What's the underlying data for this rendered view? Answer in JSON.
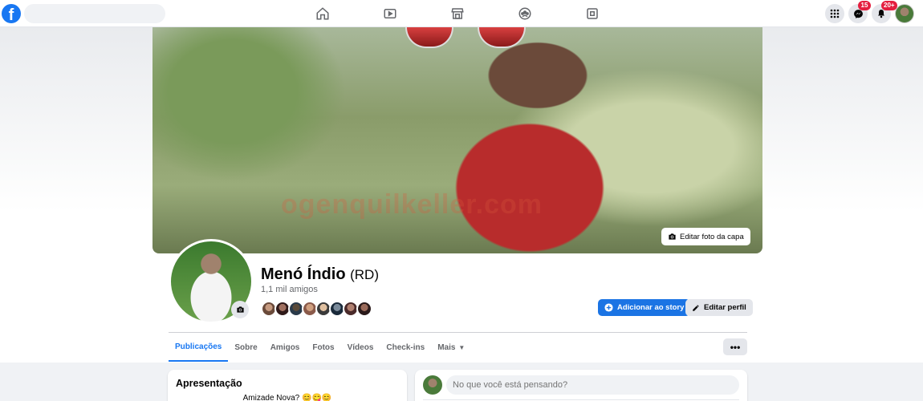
{
  "topbar": {
    "search_placeholder": "",
    "messenger_badge": "15",
    "notifications_badge": "20+"
  },
  "cover": {
    "edit_label": "Editar foto da capa"
  },
  "profile": {
    "name": "Menó Índio",
    "alternate_name": "(RD)",
    "friends_count": "1,1 mil amigos",
    "add_story_label": "Adicionar ao story",
    "edit_profile_label": "Editar perfil"
  },
  "tabs": [
    {
      "label": "Publicações",
      "active": true
    },
    {
      "label": "Sobre"
    },
    {
      "label": "Amigos"
    },
    {
      "label": "Fotos"
    },
    {
      "label": "Vídeos"
    },
    {
      "label": "Check-ins"
    },
    {
      "label": "Mais"
    }
  ],
  "more_label": "•••",
  "intro": {
    "title": "Apresentação",
    "bio": "Amizade Nova? 😊😋😊"
  },
  "composer": {
    "placeholder": "No que você está pensando?"
  },
  "watermark": "ogenquilkeller.com",
  "colors": {
    "accent": "#1877f2",
    "badge": "#e41e3f",
    "button_secondary": "#e4e6eb"
  }
}
